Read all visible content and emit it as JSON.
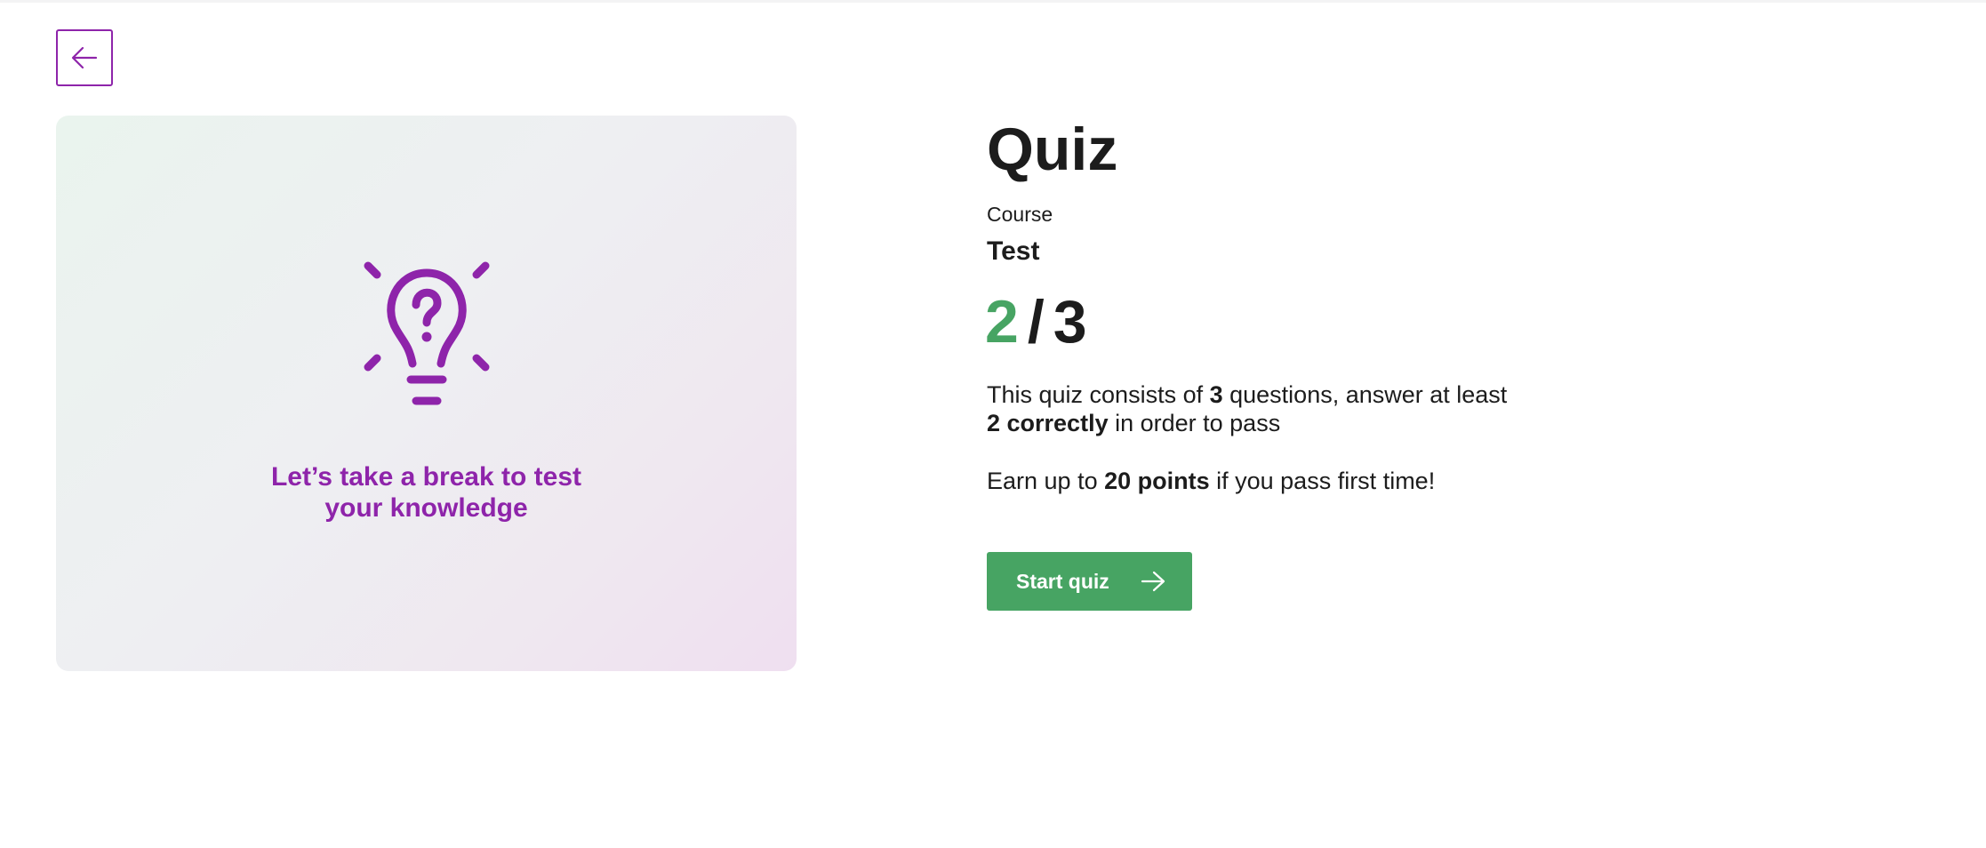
{
  "nav": {
    "back_icon": "arrow-left-icon"
  },
  "card": {
    "icon": "lightbulb-question-icon",
    "caption_line1": "Let’s take a break to test",
    "caption_line2": "your knowledge",
    "accent_color": "#8e24aa"
  },
  "quiz": {
    "title": "Quiz",
    "course_label": "Course",
    "course_name": "Test",
    "score": {
      "pass_count": "2",
      "separator": "/",
      "total": "3",
      "pass_color": "#47a463"
    },
    "description": {
      "part1": "This quiz consists of ",
      "questions": "3",
      "part2": " questions, answer at least ",
      "required": "2 correctly",
      "part3": " in order to pass"
    },
    "earn": {
      "part1": "Earn up to ",
      "points": "20 points",
      "part2": " if you pass first time!"
    },
    "start_button": {
      "label": "Start quiz",
      "icon": "arrow-right-icon",
      "color": "#47a463"
    }
  }
}
